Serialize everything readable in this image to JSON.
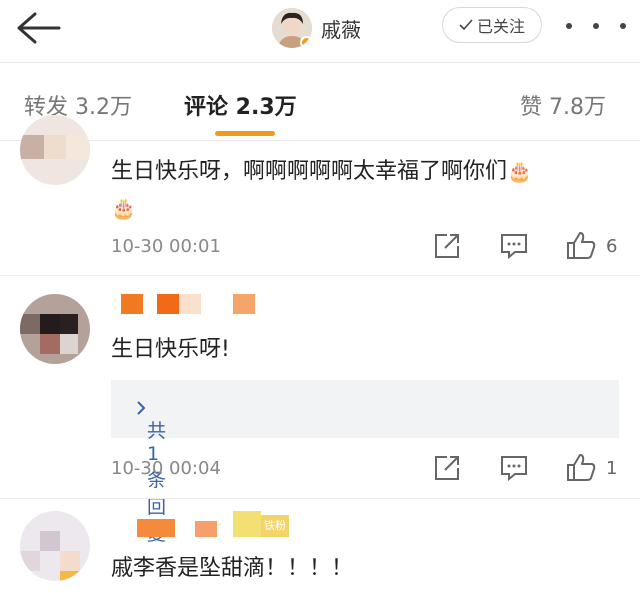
{
  "header": {
    "back_icon": "arrow-left-icon",
    "name": "戚薇",
    "follow_label": "已关注",
    "follow_icon": "check-icon",
    "more_icon": "more-dots-icon",
    "verified_color": "#f29b1d"
  },
  "tabs": [
    {
      "label": "转发 3.2万"
    },
    {
      "label": "评论 2.3万"
    },
    {
      "label": "赞 7.8万"
    }
  ],
  "accent_color": "#f39a1c",
  "comments": [
    {
      "text": "生日快乐呀，啊啊啊啊啊太幸福了啊你们",
      "date": "10-30 00:01",
      "likes": "6"
    },
    {
      "text": "生日快乐呀!",
      "reply_label": "共1条回复",
      "date": "10-30 00:04",
      "likes": "1"
    },
    {
      "text": "戚李香是坠甜滴！！！！",
      "badge": "铁粉"
    }
  ],
  "icons": {
    "share": "share-icon",
    "comment": "comment-icon",
    "like": "thumbs-up-icon"
  }
}
